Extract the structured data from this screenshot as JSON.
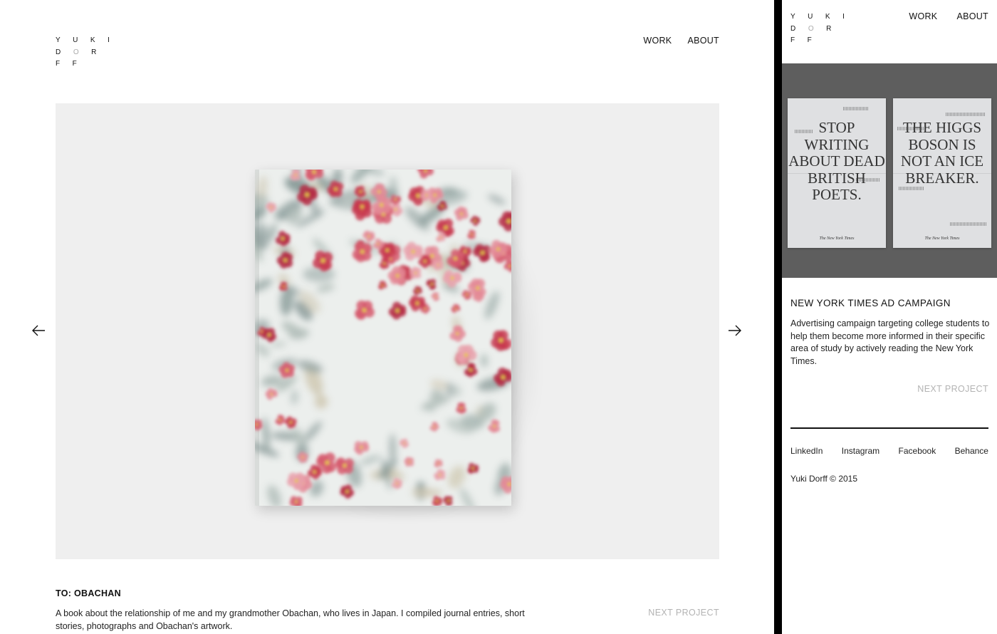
{
  "brand": {
    "lines": [
      "YUKI",
      "DORFF"
    ],
    "logo_row1": "Y U K I",
    "logo_row2_a": "D ",
    "logo_row2_dim": "O",
    "logo_row2_b": " R",
    "logo_row3": "F F"
  },
  "nav": {
    "work": "WORK",
    "about": "ABOUT"
  },
  "desktop": {
    "project_title": "TO: OBACHAN",
    "project_description": "A book about the relationship of me and my grandmother Obachan, who lives in Japan. I compiled journal entries, short stories, photographs and Obachan's artwork.",
    "next_project": "NEXT PROJECT",
    "prev_icon": "arrow-left-icon",
    "next_icon": "arrow-right-icon"
  },
  "mobile": {
    "hero_posters": [
      {
        "headline": "STOP WRITING ABOUT DEAD BRITISH POETS.",
        "masthead": "The New York Times"
      },
      {
        "headline": "THE HIGGS BOSON IS NOT AN ICE BREAKER.",
        "masthead": "The New York Times"
      }
    ],
    "project_title": "NEW YORK TIMES AD CAMPAIGN",
    "project_description": "Advertising campaign targeting college students to help them become more informed in their specific area of study by actively reading the New York Times.",
    "next_project": "NEXT PROJECT",
    "socials": [
      "LinkedIn",
      "Instagram",
      "Facebook",
      "Behance"
    ],
    "copyright": "Yuki Dorff © 2015"
  },
  "colors": {
    "stage_bg": "#efefef",
    "hero_bg": "#5e5e5e",
    "muted": "#b3b3b3",
    "divider": "#000000"
  }
}
